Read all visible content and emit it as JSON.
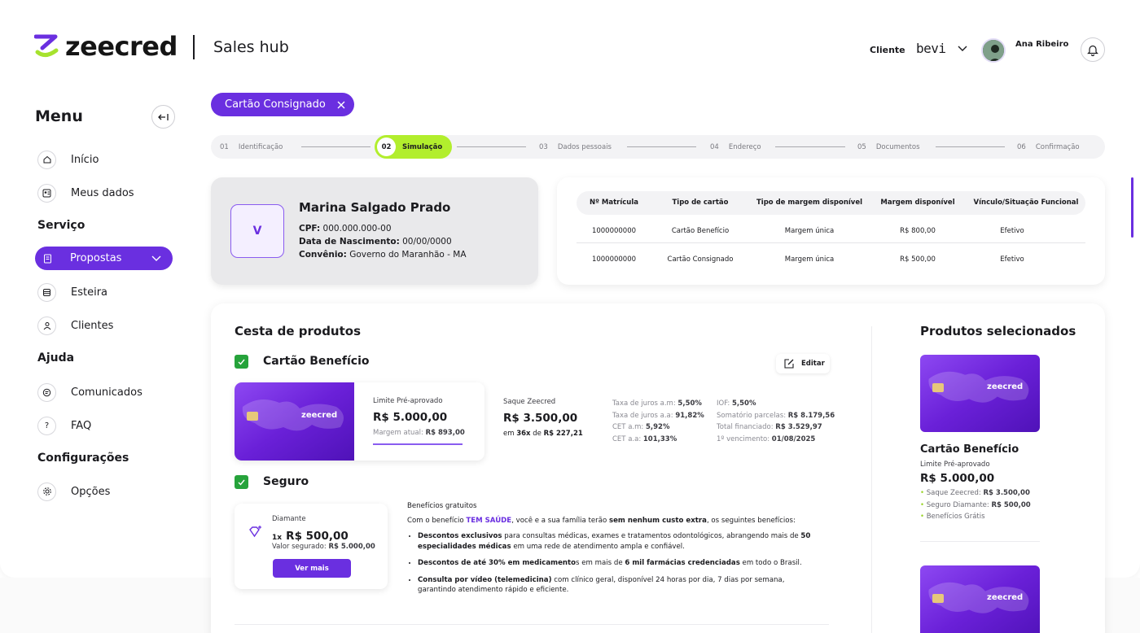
{
  "header": {
    "logo_text": "zeecred",
    "hub_title": "Sales hub",
    "client_label": "Cliente",
    "client_value": "bevi",
    "user_name": "Ana Ribeiro"
  },
  "sidebar": {
    "title": "Menu",
    "sections": {
      "servico": "Serviço",
      "ajuda": "Ajuda",
      "config": "Configurações"
    },
    "items": [
      {
        "label": "Início",
        "icon": "home-icon"
      },
      {
        "label": "Meus dados",
        "icon": "id-card-icon"
      },
      {
        "label": "Propostas",
        "icon": "document-icon"
      },
      {
        "label": "Esteira",
        "icon": "layers-icon"
      },
      {
        "label": "Clientes",
        "icon": "users-icon"
      },
      {
        "label": "Comunicados",
        "icon": "chat-icon"
      },
      {
        "label": "FAQ",
        "icon": "question-icon"
      },
      {
        "label": "Opções",
        "icon": "gear-icon"
      }
    ]
  },
  "chip": {
    "label": "Cartão Consignado"
  },
  "stepper": {
    "steps": [
      {
        "num": "01",
        "label": "Identificação"
      },
      {
        "num": "02",
        "label": "Simulação"
      },
      {
        "num": "03",
        "label": "Dados pessoais"
      },
      {
        "num": "04",
        "label": "Endereço"
      },
      {
        "num": "05",
        "label": "Documentos"
      },
      {
        "num": "06",
        "label": "Confirmação"
      }
    ],
    "active_index": 1
  },
  "customer": {
    "initial": "V",
    "name": "Marina Salgado Prado",
    "cpf_label": "CPF:",
    "cpf": "000.000.000-00",
    "birth_label": "Data de Nascimento:",
    "birth": "00/00/0000",
    "agreement_label": "Convênio:",
    "agreement": "Governo do Maranhão - MA"
  },
  "margin_table": {
    "headers": [
      "Nº Matrícula",
      "Tipo de cartão",
      "Tipo de margem disponível",
      "Margem disponível",
      "Vínculo/Situação Funcional"
    ],
    "rows": [
      [
        "1000000000",
        "Cartão Benefício",
        "Margem única",
        "R$ 800,00",
        "Efetivo"
      ],
      [
        "1000000000",
        "Cartão Consignado",
        "Margem única",
        "R$ 500,00",
        "Efetivo"
      ]
    ]
  },
  "basket": {
    "title": "Cesta de produtos",
    "product1": {
      "title": "Cartão Benefício",
      "edit_label": "Editar",
      "card_brand": "zeecred",
      "limit_label": "Limite Pré-aprovado",
      "limit_value": "R$ 5.000,00",
      "current_margin_label": "Margem atual:",
      "current_margin_value": "R$ 893,00",
      "withdraw_label": "Saque Zeecred",
      "withdraw_value": "R$ 3.500,00",
      "installments_prefix": "em",
      "installments_count": "36x",
      "installments_mid": "de",
      "installments_value": "R$ 227,21",
      "rates": [
        {
          "label": "Taxa de juros a.m:",
          "value": "5,50%"
        },
        {
          "label": "Taxa de juros a.a:",
          "value": "91,82%"
        },
        {
          "label": "CET a.m:",
          "value": "5,92%"
        },
        {
          "label": "CET a.a:",
          "value": "101,33%"
        }
      ],
      "totals": [
        {
          "label": "IOF:",
          "value": "5,50%"
        },
        {
          "label": "Somatório parcelas:",
          "value": "R$ 8.179,56"
        },
        {
          "label": "Total financiado:",
          "value": "R$ 3.529,97"
        },
        {
          "label": "1º vencimento:",
          "value": "01/08/2025"
        }
      ]
    },
    "product2": {
      "title": "Seguro",
      "plan_name": "Diamante",
      "qty": "1x",
      "price": "R$ 500,00",
      "insured_label": "Valor segurado:",
      "insured_value": "R$ 5.000,00",
      "see_more": "Ver mais",
      "benefits_title": "Benefícios gratuitos",
      "intro_a": "Com o benefício ",
      "intro_brand": "TEM SAÚDE",
      "intro_b": ", você e a sua família terão ",
      "intro_bold": "sem nenhum custo extra",
      "intro_c": ", os seguintes benefícios:",
      "b1_bold": "Descontos exclusivos",
      "b1_text": " para consultas médicas, exames e tratamentos odontológicos, abrangendo mais de ",
      "b1_bold2": "50 especialidades médicas",
      "b1_text2": " em uma rede de atendimento ampla e confiável.",
      "b2_bold": "Descontos de até 30% em medicamento",
      "b2_text": "s em mais de ",
      "b2_bold2": "6 mil farmácias credenciadas",
      "b2_text2": " em todo o Brasil.",
      "b3_bold": "Consulta por vídeo (telemedicina)",
      "b3_text": " com clínico geral, disponível 24 horas por dia, 7 dias por semana, garantindo atendimento rápido e eficiente."
    }
  },
  "selected": {
    "title": "Produtos selecionados",
    "card_brand": "zeecred",
    "product_title": "Cartão Benefício",
    "limit_label": "Limite Pré-aprovado",
    "limit_value": "R$ 5.000,00",
    "lines": [
      {
        "label": "Saque Zeecred:",
        "value": "R$ 3.500,00"
      },
      {
        "label": "Seguro Diamante:",
        "value": "R$ 500,00"
      },
      {
        "label": "Benefícios Grátis",
        "value": ""
      }
    ]
  },
  "colors": {
    "brand": "#6a2fe0",
    "accent": "#b2ee2d",
    "success": "#26a33b"
  }
}
